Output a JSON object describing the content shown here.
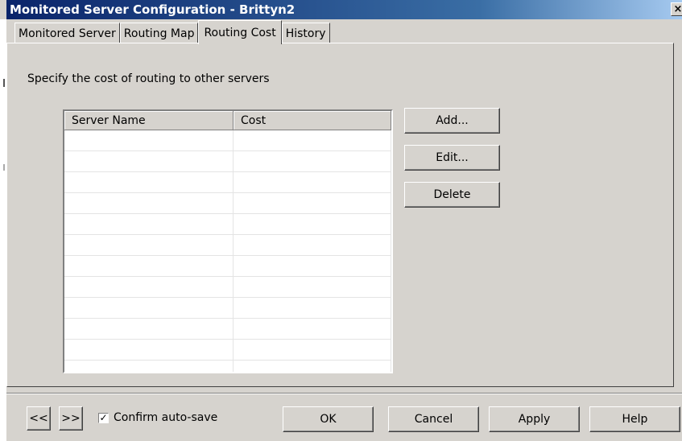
{
  "window": {
    "title": "Monitored Server Configuration - Brittyn2",
    "close_label": "×"
  },
  "tabs": [
    {
      "label": "Monitored Server",
      "active": false
    },
    {
      "label": "Routing Map",
      "active": false
    },
    {
      "label": "Routing Cost",
      "active": true
    },
    {
      "label": "History",
      "active": false
    }
  ],
  "routing_cost": {
    "instruction": "Specify the cost of routing to other servers",
    "table": {
      "columns": [
        "Server Name",
        "Cost"
      ],
      "rows": []
    },
    "buttons": {
      "add": "Add...",
      "edit": "Edit...",
      "delete": "Delete"
    }
  },
  "footer": {
    "prev_label": "<<",
    "next_label": ">>",
    "confirm_autosave": {
      "label": "Confirm auto-save",
      "checked": true,
      "check_glyph": "✓"
    },
    "ok": "OK",
    "cancel": "Cancel",
    "apply": "Apply",
    "help": "Help"
  },
  "colors": {
    "face": "#d6d3ce",
    "titlebar_start": "#0a246a",
    "titlebar_end": "#a6caf0"
  }
}
